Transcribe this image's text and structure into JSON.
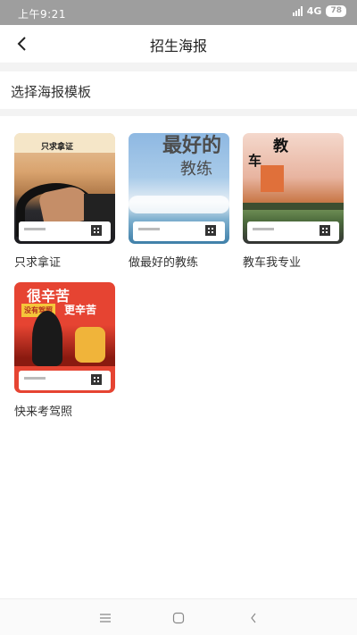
{
  "status_bar": {
    "time": "上午9:21",
    "network": "4G",
    "battery": "78"
  },
  "header": {
    "title": "招生海报"
  },
  "section": {
    "title": "选择海报模板"
  },
  "templates": [
    {
      "name": "只求拿证",
      "poster_headline": "只求拿证",
      "footer_text": "刘东驾教练"
    },
    {
      "name": "做最好的教练",
      "poster_headline": "最好的",
      "poster_sub": "教练",
      "footer_text": "刘东驾教练"
    },
    {
      "name": "教车我专业",
      "poster_headline": "教",
      "poster_sub": "车",
      "footer_text": "刘东驾教练"
    },
    {
      "name": "快来考驾照",
      "poster_headline": "很辛苦",
      "poster_tag": "没有驾照",
      "poster_sub": "更辛苦",
      "footer_text": "刘东驾教练"
    }
  ],
  "colors": {
    "status_bar": "#9e9e9e",
    "divider": "#f3f3f3",
    "poster_red": "#e64432"
  }
}
